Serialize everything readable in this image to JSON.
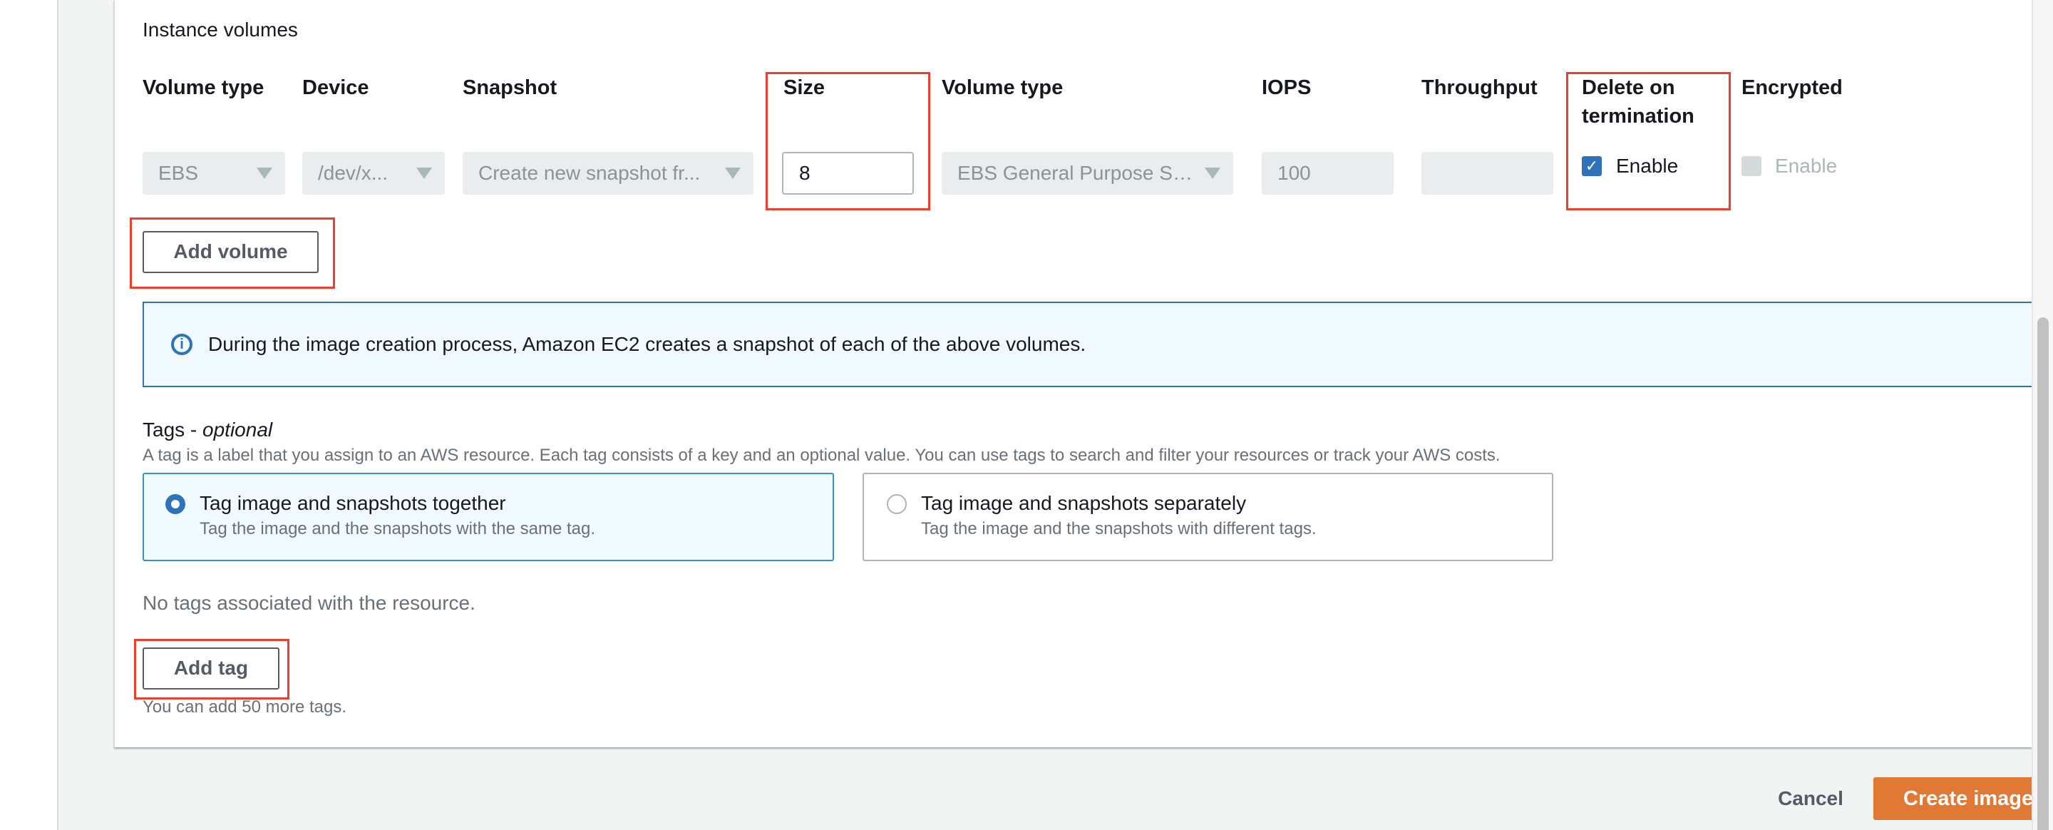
{
  "instance_volumes": {
    "title": "Instance volumes",
    "columns": [
      "Volume type",
      "Device",
      "Snapshot",
      "Size",
      "Volume type",
      "IOPS",
      "Throughput",
      "Delete on termination",
      "Encrypted"
    ],
    "column_lines": {
      "delete_line1": "Delete on",
      "delete_line2": "termination"
    },
    "row": {
      "volume_type": "EBS",
      "device": "/dev/x...",
      "snapshot": "Create new snapshot fr...",
      "size": "8",
      "ebs_volume_type": "EBS General Purpose SS...",
      "iops": "100",
      "throughput": "",
      "delete_on_termination": {
        "label": "Enable",
        "checked": true,
        "check_glyph": "✓"
      },
      "encrypted": {
        "label": "Enable",
        "checked": false,
        "disabled": true
      }
    },
    "add_volume_label": "Add volume"
  },
  "info": {
    "icon": "info-icon",
    "icon_glyph": "i",
    "text": "During the image creation process, Amazon EC2 creates a snapshot of each of the above volumes."
  },
  "tags": {
    "title": "Tags - ",
    "title_optional": "optional",
    "description": "A tag is a label that you assign to an AWS resource. Each tag consists of a key and an optional value. You can use tags to search and filter your resources or track your AWS costs.",
    "options": [
      {
        "label": "Tag image and snapshots together",
        "description": "Tag the image and the snapshots with the same tag.",
        "selected": true
      },
      {
        "label": "Tag image and snapshots separately",
        "description": "Tag the image and the snapshots with different tags.",
        "selected": false
      }
    ],
    "empty_text": "No tags associated with the resource.",
    "add_tag_label": "Add tag",
    "remaining_text": "You can add 50 more tags."
  },
  "footer": {
    "cancel_label": "Cancel",
    "create_label": "Create image"
  },
  "colors": {
    "primary_button": "#e07933",
    "highlight": "#e8422e",
    "info_border": "#2e73b8",
    "checkbox": "#2e73b8"
  }
}
